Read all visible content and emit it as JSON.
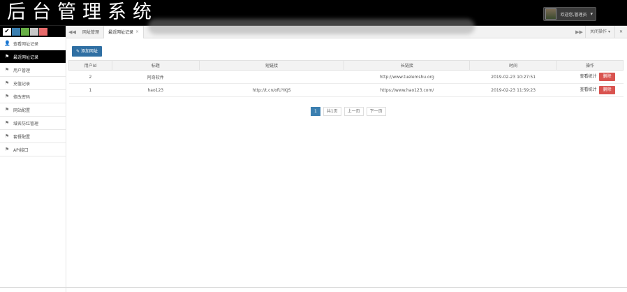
{
  "header": {
    "title": "后台管理系统",
    "user_name": "欢迎您,管理员"
  },
  "theme_colors": [
    "#ffffff",
    "#3b7fb0",
    "#68b046",
    "#c8c8c8",
    "#e86b6b"
  ],
  "sidebar": {
    "items": [
      {
        "label": "查看网址记录",
        "icon": "user-icon",
        "active": false
      },
      {
        "label": "最近网址记录",
        "icon": "bookmark-icon",
        "active": true
      },
      {
        "label": "用户管理",
        "icon": "bookmark-icon",
        "active": false
      },
      {
        "label": "充值记录",
        "icon": "bookmark-icon",
        "active": false
      },
      {
        "label": "修改密码",
        "icon": "bookmark-icon",
        "active": false
      },
      {
        "label": "网站配置",
        "icon": "bookmark-icon",
        "active": false
      },
      {
        "label": "域名防红管理",
        "icon": "bookmark-icon",
        "active": false
      },
      {
        "label": "套餐配置",
        "icon": "bookmark-icon",
        "active": false
      },
      {
        "label": "API接口",
        "icon": "bookmark-icon",
        "active": false
      }
    ]
  },
  "tabs": {
    "items": [
      {
        "label": "网址管理",
        "active": false
      },
      {
        "label": "最近网址记录",
        "active": true
      }
    ],
    "close_all": "关闭操作"
  },
  "toolbar": {
    "add_label": "添加网址"
  },
  "table": {
    "headers": [
      "用户Id",
      "标题",
      "短链接",
      "长链接",
      "时间",
      "操作"
    ],
    "rows": [
      {
        "user_id": "2",
        "title": "阿奇软件",
        "short": "",
        "long": "http://www.tuelemshu.org",
        "time": "2019-02-23 10:27:51",
        "stat": "查看统计",
        "del": "删除"
      },
      {
        "user_id": "1",
        "title": "hao123",
        "short": "http://t.cn/ofUYKJS",
        "long": "https://www.hao123.com/",
        "time": "2019-02-23 11:59:23",
        "stat": "查看统计",
        "del": "删除"
      }
    ]
  },
  "pager": {
    "current": "1",
    "total": "共1页",
    "prev": "上一页",
    "next": "下一页"
  }
}
